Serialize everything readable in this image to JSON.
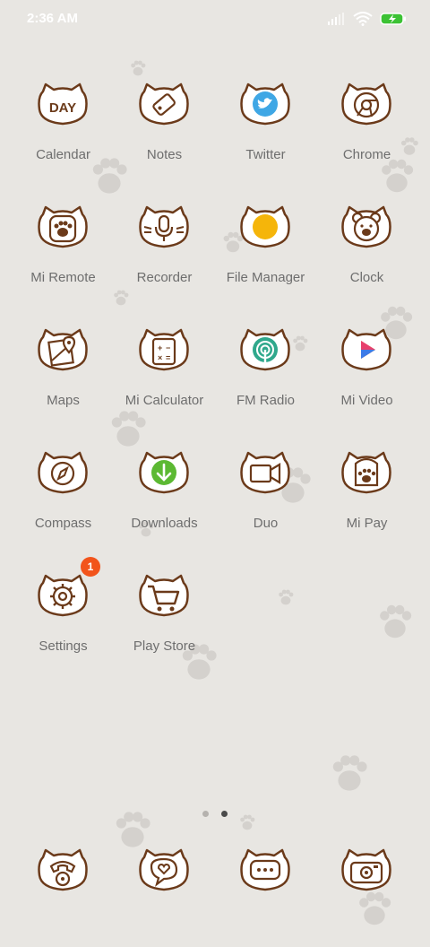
{
  "status_bar": {
    "time": "2:36 AM",
    "icons": [
      "signal-icon",
      "wifi-icon",
      "battery-charging-icon"
    ]
  },
  "apps": [
    {
      "label": "Calendar",
      "icon": "calendar-day-icon",
      "icon_text": "DAY"
    },
    {
      "label": "Notes",
      "icon": "notes-tag-icon"
    },
    {
      "label": "Twitter",
      "icon": "twitter-icon"
    },
    {
      "label": "Chrome",
      "icon": "chrome-icon"
    },
    {
      "label": "Mi Remote",
      "icon": "paw-icon"
    },
    {
      "label": "Recorder",
      "icon": "microphone-icon"
    },
    {
      "label": "File Manager",
      "icon": "file-manager-icon"
    },
    {
      "label": "Clock",
      "icon": "bear-clock-icon"
    },
    {
      "label": "Maps",
      "icon": "map-pin-icon"
    },
    {
      "label": "Mi Calculator",
      "icon": "calculator-icon"
    },
    {
      "label": "FM Radio",
      "icon": "radio-icon"
    },
    {
      "label": "Mi Video",
      "icon": "video-play-icon"
    },
    {
      "label": "Compass",
      "icon": "compass-icon"
    },
    {
      "label": "Downloads",
      "icon": "download-icon"
    },
    {
      "label": "Duo",
      "icon": "video-camera-icon"
    },
    {
      "label": "Mi Pay",
      "icon": "mi-pay-paw-icon"
    },
    {
      "label": "Settings",
      "icon": "settings-gear-icon",
      "badge": "1"
    },
    {
      "label": "Play Store",
      "icon": "shopping-cart-icon"
    }
  ],
  "page_indicator": {
    "pages": 2,
    "current": 2
  },
  "dock": [
    {
      "icon": "phone-icon"
    },
    {
      "icon": "messages-heart-icon"
    },
    {
      "icon": "chat-bubble-icon"
    },
    {
      "icon": "camera-icon"
    }
  ],
  "colors": {
    "background": "#e8e6e2",
    "icon_outline": "#6b3a1a",
    "label": "#6e6e6e",
    "badge": "#f2541b",
    "paw_print": "#cfccc8"
  }
}
